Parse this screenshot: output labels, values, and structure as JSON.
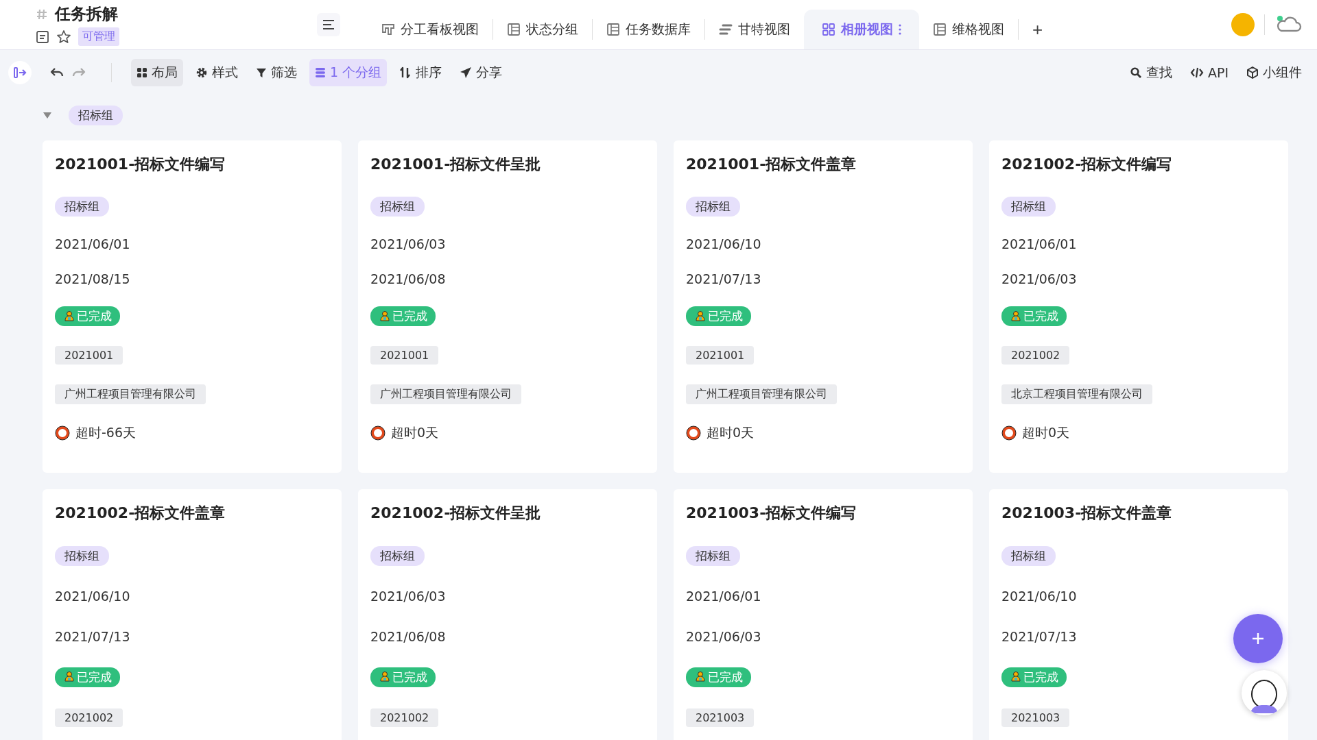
{
  "header": {
    "title": "任务拆解",
    "permission": "可管理"
  },
  "view_tabs": [
    {
      "label": "分工看板视图",
      "kind": "kanban",
      "selected": false
    },
    {
      "label": "状态分组",
      "kind": "grid",
      "selected": false
    },
    {
      "label": "任务数据库",
      "kind": "grid",
      "selected": false
    },
    {
      "label": "甘特视图",
      "kind": "gantt",
      "selected": false
    },
    {
      "label": "相册视图",
      "kind": "gallery",
      "selected": true
    },
    {
      "label": "维格视图",
      "kind": "grid",
      "selected": false
    }
  ],
  "add_tab": "+",
  "toolbar": [
    {
      "label": "布局",
      "kind": "layout",
      "active": false,
      "hovered": true
    },
    {
      "label": "样式",
      "kind": "style",
      "active": false,
      "hovered": false
    },
    {
      "label": "筛选",
      "kind": "filter",
      "active": false,
      "hovered": false
    },
    {
      "label": "1 个分组",
      "kind": "group",
      "active": true,
      "hovered": false
    },
    {
      "label": "排序",
      "kind": "sort",
      "active": false,
      "hovered": false
    },
    {
      "label": "分享",
      "kind": "share",
      "active": false,
      "hovered": false
    }
  ],
  "toolbar_right": [
    {
      "label": "查找",
      "kind": "search"
    },
    {
      "label": "API",
      "kind": "api"
    },
    {
      "label": "小组件",
      "kind": "widget"
    }
  ],
  "group": {
    "label": "招标组",
    "expanded": true
  },
  "cards": [
    {
      "title": "2021001-招标文件编写",
      "tag": "招标组",
      "start": "2021/06/01",
      "end": "2021/08/15",
      "status": "已完成",
      "code": "2021001",
      "company": "广州工程项目管理有限公司",
      "overdue": "超时-66天"
    },
    {
      "title": "2021001-招标文件呈批",
      "tag": "招标组",
      "start": "2021/06/03",
      "end": "2021/06/08",
      "status": "已完成",
      "code": "2021001",
      "company": "广州工程项目管理有限公司",
      "overdue": "超时0天"
    },
    {
      "title": "2021001-招标文件盖章",
      "tag": "招标组",
      "start": "2021/06/10",
      "end": "2021/07/13",
      "status": "已完成",
      "code": "2021001",
      "company": "广州工程项目管理有限公司",
      "overdue": "超时0天"
    },
    {
      "title": "2021002-招标文件编写",
      "tag": "招标组",
      "start": "2021/06/01",
      "end": "2021/06/03",
      "status": "已完成",
      "code": "2021002",
      "company": "北京工程项目管理有限公司",
      "overdue": "超时0天"
    },
    {
      "title": "2021002-招标文件盖章",
      "tag": "招标组",
      "start": "2021/06/10",
      "end": "2021/07/13",
      "status": "已完成",
      "code": "2021002"
    },
    {
      "title": "2021002-招标文件呈批",
      "tag": "招标组",
      "start": "2021/06/03",
      "end": "2021/06/08",
      "status": "已完成",
      "code": "2021002"
    },
    {
      "title": "2021003-招标文件编写",
      "tag": "招标组",
      "start": "2021/06/01",
      "end": "2021/06/03",
      "status": "已完成",
      "code": "2021003"
    },
    {
      "title": "2021003-招标文件盖章",
      "tag": "招标组",
      "start": "2021/06/10",
      "end": "2021/07/13",
      "status": "已完成",
      "code": "2021003"
    }
  ]
}
